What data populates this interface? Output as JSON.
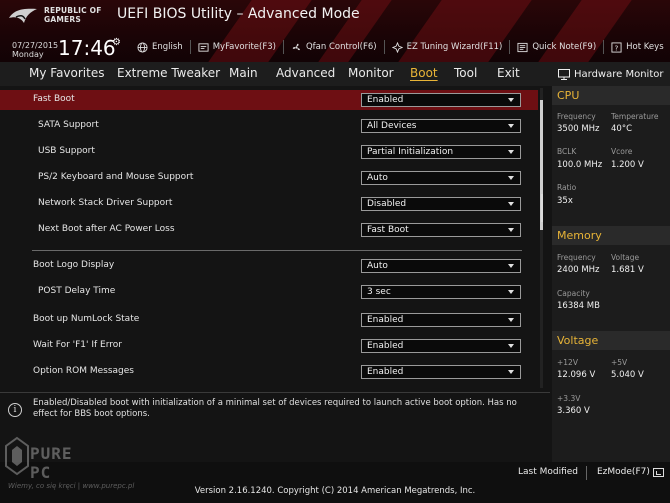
{
  "app": {
    "brand": "REPUBLIC OF GAMERS",
    "title": "UEFI BIOS Utility – Advanced Mode"
  },
  "clock": {
    "date": "07/27/2015",
    "day": "Monday",
    "time": "17:46"
  },
  "toolbar": [
    {
      "label": "English",
      "icon": "globe-icon"
    },
    {
      "label": "MyFavorite(F3)",
      "icon": "favorite-icon"
    },
    {
      "label": "Qfan Control(F6)",
      "icon": "fan-icon"
    },
    {
      "label": "EZ Tuning Wizard(F11)",
      "icon": "wizard-icon"
    },
    {
      "label": "Quick Note(F9)",
      "icon": "note-icon"
    },
    {
      "label": "Hot Keys",
      "icon": "help-icon"
    }
  ],
  "tabs": [
    {
      "label": "My Favorites"
    },
    {
      "label": "Extreme Tweaker"
    },
    {
      "label": "Main"
    },
    {
      "label": "Advanced"
    },
    {
      "label": "Monitor"
    },
    {
      "label": "Boot",
      "active": true
    },
    {
      "label": "Tool"
    },
    {
      "label": "Exit"
    }
  ],
  "settings": [
    {
      "label": "Fast Boot",
      "value": "Enabled",
      "highlight": true
    },
    {
      "label": "SATA Support",
      "value": "All Devices"
    },
    {
      "label": "USB Support",
      "value": "Partial Initialization"
    },
    {
      "label": "PS/2 Keyboard and Mouse Support",
      "value": "Auto"
    },
    {
      "label": "Network Stack Driver Support",
      "value": "Disabled"
    },
    {
      "label": "Next Boot after AC Power Loss",
      "value": "Fast Boot"
    },
    {
      "label": "Boot Logo Display",
      "value": "Auto"
    },
    {
      "label": "POST Delay Time",
      "value": "3 sec"
    },
    {
      "label": "Boot up NumLock State",
      "value": "Enabled"
    },
    {
      "label": "Wait For 'F1' If Error",
      "value": "Enabled"
    },
    {
      "label": "Option ROM Messages",
      "value": "Enabled"
    }
  ],
  "help_text": "Enabled/Disabled boot with initialization of a minimal set of devices required to launch active boot option. Has no effect for BBS boot options.",
  "hardware_monitor": {
    "title": "Hardware Monitor",
    "cpu": {
      "heading": "CPU",
      "frequency_label": "Frequency",
      "frequency": "3500 MHz",
      "temperature_label": "Temperature",
      "temperature": "40°C",
      "bclk_label": "BCLK",
      "bclk": "100.0 MHz",
      "vcore_label": "Vcore",
      "vcore": "1.200 V",
      "ratio_label": "Ratio",
      "ratio": "35x"
    },
    "memory": {
      "heading": "Memory",
      "frequency_label": "Frequency",
      "frequency": "2400 MHz",
      "voltage_label": "Voltage",
      "voltage": "1.681 V",
      "capacity_label": "Capacity",
      "capacity": "16384 MB"
    },
    "voltage": {
      "heading": "Voltage",
      "v12_label": "+12V",
      "v12": "12.096 V",
      "v5_label": "+5V",
      "v5": "5.040 V",
      "v33_label": "+3.3V",
      "v33": "3.360 V"
    }
  },
  "footer": {
    "last_modified": "Last Modified",
    "ez_mode": "EzMode(F7)",
    "version": "Version 2.16.1240. Copyright (C) 2014 American Megatrends, Inc."
  },
  "watermark": {
    "name": "PURE PC",
    "caption": "Wiemy, co się kręci | www.purepc.pl"
  },
  "colors": {
    "accent": "#e8b437",
    "highlight_row": "#6e0f13",
    "header_red": "#2a0608"
  }
}
